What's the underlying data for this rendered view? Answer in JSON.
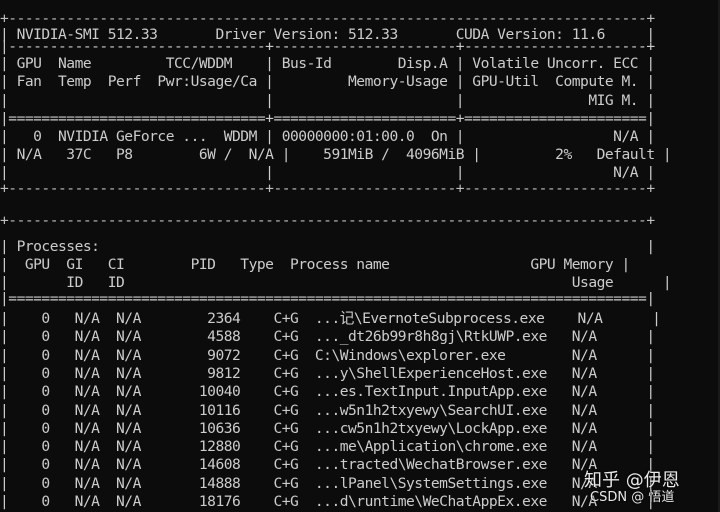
{
  "header": {
    "smi_version": "NVIDIA-SMI 512.33",
    "driver_version": "Driver Version: 512.33",
    "cuda_version": "CUDA Version: 11.6"
  },
  "gpu_table": {
    "columns": {
      "c1_r1": "GPU  Name        TCC/WDDM",
      "c1_r2": "Fan  Temp  Perf  Pwr:Usage/Cap",
      "c2_r1": "Bus-Id        Disp.A",
      "c2_r2": "Memory-Usage",
      "c3_r1": "Volatile Uncorr. ECC",
      "c3_r2": "GPU-Util  Compute M.",
      "c3_r3": "MIG M."
    },
    "gpus": [
      {
        "index": "0",
        "name": "NVIDIA GeForce ...",
        "mode": "WDDM",
        "bus_id": "00000000:01:00.0",
        "disp_a": "On",
        "ecc": "N/A",
        "fan": "N/A",
        "temp": "37C",
        "perf": "P8",
        "power": "6W /  N/A",
        "memory_usage": "591MiB /  4096MiB",
        "gpu_util": "2%",
        "compute_mode": "Default",
        "mig_mode": "N/A"
      }
    ]
  },
  "processes": {
    "title": "Processes:",
    "headers": {
      "gpu": "GPU",
      "gi": "GI",
      "gi2": "ID",
      "ci": "CI",
      "ci2": "ID",
      "pid": "PID",
      "type": "Type",
      "name": "Process name",
      "mem": "GPU Memory",
      "mem2": "Usage"
    },
    "rows": [
      {
        "gpu": "0",
        "gi": "N/A",
        "ci": "N/A",
        "pid": "2364",
        "type": "C+G",
        "name": "...记\\EvernoteSubprocess.exe",
        "mem": "N/A"
      },
      {
        "gpu": "0",
        "gi": "N/A",
        "ci": "N/A",
        "pid": "4588",
        "type": "C+G",
        "name": "..._dt26b99r8h8gj\\RtkUWP.exe",
        "mem": "N/A"
      },
      {
        "gpu": "0",
        "gi": "N/A",
        "ci": "N/A",
        "pid": "9072",
        "type": "C+G",
        "name": "C:\\Windows\\explorer.exe",
        "mem": "N/A"
      },
      {
        "gpu": "0",
        "gi": "N/A",
        "ci": "N/A",
        "pid": "9812",
        "type": "C+G",
        "name": "...y\\ShellExperienceHost.exe",
        "mem": "N/A"
      },
      {
        "gpu": "0",
        "gi": "N/A",
        "ci": "N/A",
        "pid": "10040",
        "type": "C+G",
        "name": "...es.TextInput.InputApp.exe",
        "mem": "N/A"
      },
      {
        "gpu": "0",
        "gi": "N/A",
        "ci": "N/A",
        "pid": "10116",
        "type": "C+G",
        "name": "...w5n1h2txyewy\\SearchUI.exe",
        "mem": "N/A"
      },
      {
        "gpu": "0",
        "gi": "N/A",
        "ci": "N/A",
        "pid": "10636",
        "type": "C+G",
        "name": "...cw5n1h2txyewy\\LockApp.exe",
        "mem": "N/A"
      },
      {
        "gpu": "0",
        "gi": "N/A",
        "ci": "N/A",
        "pid": "12880",
        "type": "C+G",
        "name": "...me\\Application\\chrome.exe",
        "mem": "N/A"
      },
      {
        "gpu": "0",
        "gi": "N/A",
        "ci": "N/A",
        "pid": "14608",
        "type": "C+G",
        "name": "...tracted\\WechatBrowser.exe",
        "mem": "N/A"
      },
      {
        "gpu": "0",
        "gi": "N/A",
        "ci": "N/A",
        "pid": "14888",
        "type": "C+G",
        "name": "...lPanel\\SystemSettings.exe",
        "mem": "N/A"
      },
      {
        "gpu": "0",
        "gi": "N/A",
        "ci": "N/A",
        "pid": "18176",
        "type": "C+G",
        "name": "...d\\runtime\\WeChatAppEx.exe",
        "mem": "N/A"
      }
    ]
  },
  "watermarks": {
    "zhihu": "知乎 @伊恩",
    "csdn": "CSDN @ 悟道"
  }
}
